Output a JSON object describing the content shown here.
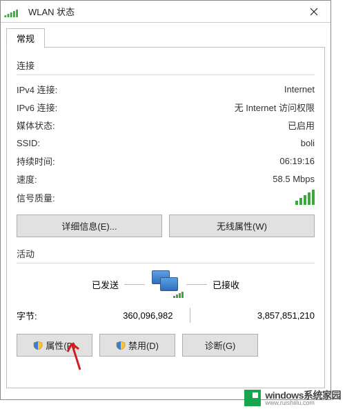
{
  "window": {
    "title": "WLAN 状态",
    "tab_label": "常规"
  },
  "sections": {
    "connection_head": "连接",
    "activity_head": "活动"
  },
  "conn": {
    "ipv4_label": "IPv4 连接:",
    "ipv4_value": "Internet",
    "ipv6_label": "IPv6 连接:",
    "ipv6_value": "无 Internet 访问权限",
    "media_label": "媒体状态:",
    "media_value": "已启用",
    "ssid_label": "SSID:",
    "ssid_value": "boli",
    "duration_label": "持续时间:",
    "duration_value": "06:19:16",
    "speed_label": "速度:",
    "speed_value": "58.5 Mbps",
    "signal_label": "信号质量:"
  },
  "buttons": {
    "details": "详细信息(E)...",
    "wireless_props": "无线属性(W)",
    "properties": "属性(P)",
    "disable": "禁用(D)",
    "diagnose": "诊断(G)"
  },
  "activity": {
    "sent_label": "已发送",
    "received_label": "已接收",
    "bytes_label": "字节:",
    "bytes_sent": "360,096,982",
    "bytes_received": "3,857,851,210"
  },
  "watermark": {
    "brand": "windows系统家园",
    "url": "www.ruishiilu.com"
  }
}
